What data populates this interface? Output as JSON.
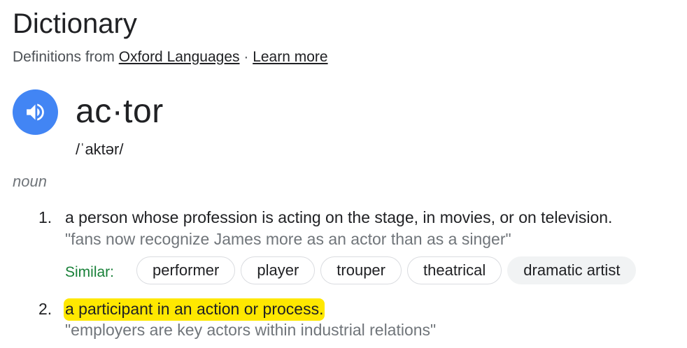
{
  "header": {
    "title": "Dictionary",
    "source_prefix": "Definitions from ",
    "source_link": "Oxford Languages",
    "separator": " · ",
    "learn_more": "Learn more"
  },
  "entry": {
    "speaker_icon": "volume-icon",
    "word": "ac·tor",
    "phonetic": "/ˈaktər/",
    "part_of_speech": "noun"
  },
  "definitions": [
    {
      "number": "1.",
      "text": "a person whose profession is acting on the stage, in movies, or on television.",
      "example": "\"fans now recognize James more as an actor than as a singer\""
    },
    {
      "number": "2.",
      "text": "a participant in an action or process.",
      "example": "\"employers are key actors within industrial relations\""
    }
  ],
  "similar": {
    "label": "Similar:",
    "chips": [
      "performer",
      "player",
      "trouper",
      "theatrical",
      "dramatic artist"
    ]
  },
  "colors": {
    "speaker": "#4285f4",
    "similar_label": "#188038",
    "highlight": "#ffe800"
  }
}
